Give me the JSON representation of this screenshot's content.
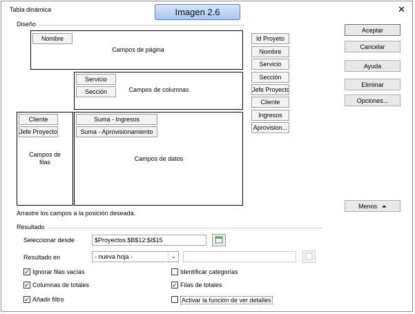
{
  "window": {
    "title": "Tabla dinámica",
    "close_glyph": "✕"
  },
  "badge": "Imagen 2.6",
  "layout_section": {
    "label": "Diseño",
    "page_area": {
      "label": "Campos de página",
      "fields": [
        "Nombre"
      ]
    },
    "column_area": {
      "label": "Campos de columnas",
      "fields": [
        "Servicio",
        "Sección"
      ]
    },
    "row_area": {
      "label_line1": "Campos de",
      "label_line2": "filas",
      "fields": [
        "Cliente",
        "Jefe Proyecto"
      ]
    },
    "data_area": {
      "label": "Campos de datos",
      "fields": [
        "Suma - Ingresos",
        "Suma - Aprovisionamiento"
      ]
    },
    "available_fields": [
      "Id Proyeto",
      "Nombre",
      "Servicio",
      "Sección",
      "Jefe Proyecto",
      "Cliente",
      "Ingresos",
      "Aprovision..."
    ],
    "hint": "Arrastre los campos a la posición deseada."
  },
  "buttons": {
    "accept": "Aceptar",
    "cancel": "Cancelar",
    "help": "Ayuda",
    "remove": "Eliminar",
    "options": "Opciones...",
    "less": "Menos",
    "less_icon": "double-chevron-up-icon"
  },
  "result_section": {
    "label": "Resultado",
    "select_from_label": "Seleccionar desde",
    "select_from_value": "$Proyectos.$B$12:$I$15",
    "result_in_label": "Resultado en",
    "result_in_value": "- nueva hoja -",
    "result_in_target": ""
  },
  "options": [
    {
      "label": "Ignorar filas vacías",
      "checked": true
    },
    {
      "label": "Identificar categorías",
      "checked": false
    },
    {
      "label": "Columnas de totales",
      "checked": true
    },
    {
      "label": "Filas de totales",
      "checked": true
    },
    {
      "label": "Añadir filtro",
      "checked": true
    },
    {
      "label": "Activar la función de ver detalles",
      "checked": false
    }
  ],
  "colors": {
    "default_button_border": "#2d7fd6",
    "badge_border": "#5a7fb0"
  }
}
